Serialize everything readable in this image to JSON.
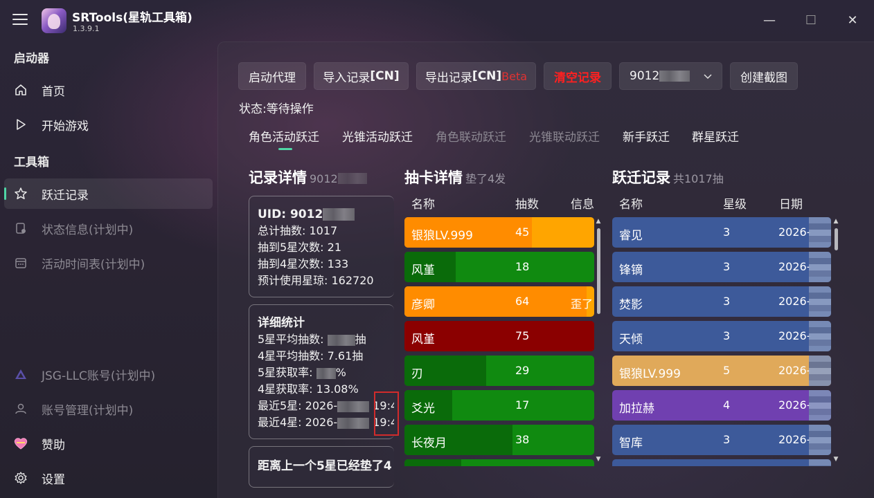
{
  "app": {
    "title": "SRTools(星轨工具箱)",
    "version": "1.3.9.1"
  },
  "window": {
    "minimize": "—",
    "maximize": "☐",
    "close": "✕"
  },
  "sidebar": {
    "sections": {
      "launcher": "启动器",
      "toolbox": "工具箱"
    },
    "items": [
      {
        "label": "首页",
        "icon": "home-icon"
      },
      {
        "label": "开始游戏",
        "icon": "play-icon"
      },
      {
        "label": "跃迁记录",
        "icon": "star-icon",
        "active": true
      },
      {
        "label": "状态信息(计划中)",
        "icon": "status-icon",
        "disabled": true
      },
      {
        "label": "活动时间表(计划中)",
        "icon": "calendar-icon",
        "disabled": true
      },
      {
        "label": "JSG-LLC账号(计划中)",
        "icon": "jsg-logo-icon",
        "disabled": true
      },
      {
        "label": "账号管理(计划中)",
        "icon": "user-icon",
        "disabled": true
      },
      {
        "label": "赞助",
        "icon": "heart-icon"
      },
      {
        "label": "设置",
        "icon": "gear-icon"
      }
    ]
  },
  "toolbar": {
    "start_proxy": "启动代理",
    "import_prefix": "导入记录",
    "import_suffix": "[CN]",
    "export_prefix": "导出记录",
    "export_suffix": "[CN]",
    "export_beta": "Beta",
    "clear": "清空记录",
    "uid_prefix": "9012",
    "screenshot": "创建截图"
  },
  "status": "状态:等待操作",
  "tabs": [
    {
      "label": "角色活动跃迁",
      "active": true
    },
    {
      "label": "光锥活动跃迁"
    },
    {
      "label": "角色联动跃迁",
      "disabled": true
    },
    {
      "label": "光锥联动跃迁",
      "disabled": true
    },
    {
      "label": "新手跃迁"
    },
    {
      "label": "群星跃迁"
    }
  ],
  "record_detail": {
    "title": "记录详情",
    "uid_sub": "9012",
    "summary": {
      "uid_label": "UID: 9012",
      "total": "总计抽数: 1017",
      "five_star_count": "抽到5星次数: 21",
      "four_star_count": "抽到4星次数: 133",
      "jade": "预计使用星琼: 162720"
    },
    "stats": {
      "title": "详细统计",
      "avg5_prefix": "5星平均抽数:",
      "avg5_suffix": "抽",
      "avg4": "4星平均抽数: 7.61抽",
      "rate5_prefix": "5星获取率:",
      "rate5_suffix": "%",
      "rate4": "4星获取率: 13.08%",
      "last5_prefix": "最近5星: 2026-",
      "last5_suffix": "19:4",
      "last4_prefix": "最近4星: 2026-",
      "last4_suffix": "19:4"
    },
    "pity_card": "距离上一个5星已经垫了4"
  },
  "pull_detail": {
    "title": "抽卡详情",
    "sub": "垫了4发",
    "columns": [
      "名称",
      "抽数",
      "信息"
    ],
    "rows": [
      {
        "name": "银狼LV.999",
        "count": "45",
        "info": "",
        "fill": 0.67,
        "color": "#ff8c00",
        "rest": "#ffa500"
      },
      {
        "name": "风堇",
        "count": "18",
        "info": "",
        "fill": 0.27,
        "color": "#0a6b0a",
        "rest": "#108a10"
      },
      {
        "name": "彦卿",
        "count": "64",
        "info": "歪了",
        "fill": 0.96,
        "color": "#ff8c00",
        "rest": "#ffa500"
      },
      {
        "name": "风堇",
        "count": "75",
        "info": "",
        "fill": 1.0,
        "color": "#8b0000",
        "rest": "#8b0000"
      },
      {
        "name": "刃",
        "count": "29",
        "info": "",
        "fill": 0.43,
        "color": "#0a6b0a",
        "rest": "#108a10"
      },
      {
        "name": "爻光",
        "count": "17",
        "info": "",
        "fill": 0.25,
        "color": "#0a6b0a",
        "rest": "#108a10"
      },
      {
        "name": "长夜月",
        "count": "38",
        "info": "",
        "fill": 0.57,
        "color": "#0a6b0a",
        "rest": "#108a10"
      },
      {
        "name": "",
        "count": "",
        "info": "",
        "fill": 0.3,
        "color": "#0a6b0a",
        "rest": "#108a10"
      }
    ]
  },
  "warp_records": {
    "title": "跃迁记录",
    "sub": "共1017抽",
    "columns": [
      "名称",
      "星级",
      "日期"
    ],
    "rows": [
      {
        "name": "睿见",
        "star": "3",
        "date": "2026-",
        "color": "#3d5a9a"
      },
      {
        "name": "锋镝",
        "star": "3",
        "date": "2026-",
        "color": "#3d5a9a"
      },
      {
        "name": "焚影",
        "star": "3",
        "date": "2026-",
        "color": "#3d5a9a"
      },
      {
        "name": "天倾",
        "star": "3",
        "date": "2026-",
        "color": "#3d5a9a"
      },
      {
        "name": "银狼LV.999",
        "star": "5",
        "date": "2026-",
        "color": "#e0a95a"
      },
      {
        "name": "加拉赫",
        "star": "4",
        "date": "2026-",
        "color": "#7040b0"
      },
      {
        "name": "智库",
        "star": "3",
        "date": "2026-",
        "color": "#3d5a9a"
      },
      {
        "name": "",
        "star": "",
        "date": "",
        "color": "#3d5a9a"
      }
    ]
  }
}
